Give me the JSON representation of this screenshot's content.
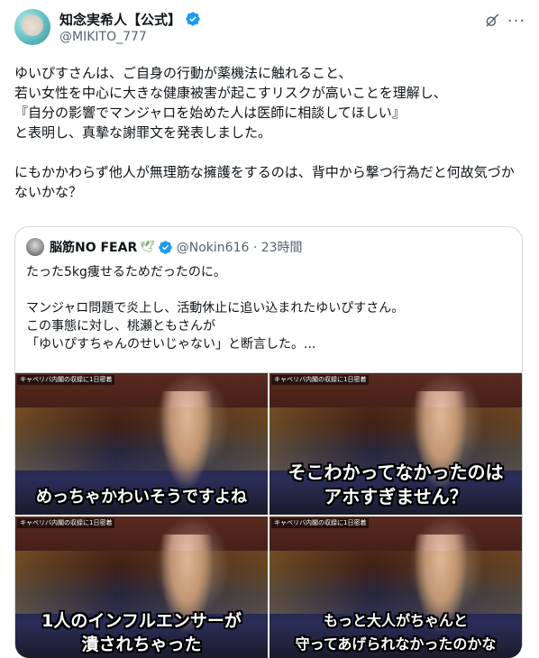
{
  "author": {
    "display_name": "知念実希人【公式】",
    "handle": "@MIKITO_777",
    "avatar_icon": "avatar-icon",
    "verified_color": "#1d9bf0"
  },
  "header_icons": {
    "grok": "grok-icon",
    "more": "more-icon"
  },
  "tweet": {
    "text": "ゆいぴすさんは、ご自身の行動が薬機法に触れること、\n若い女性を中心に大きな健康被害が起こすリスクが高いことを理解し、\n『自分の影響でマンジャロを始めた人は医師に相談してほしい』\nと表明し、真摯な謝罪文を発表しました。\n\nにもかかわらず他人が無理筋な擁護をするのは、背中から撃つ行為だと何故気づかないかな？"
  },
  "quote": {
    "display_name": "脳筋NO FEAR",
    "emoji": "🕊",
    "handle_time": "@Nokin616 · 23時間",
    "text": "たった5kg痩せるためだったのに。\n\nマンジャロ問題で炎上し、活動休止に追い込まれたゆいぴすさん。\nこの事態に対し、桃瀬ともさんが\n「ゆいぴすちゃんのせいじゃない」と断言した。...",
    "media": [
      {
        "tag": "キャベリバ内閣の収録に1日密着",
        "caption": "めっちゃかわいそうですよね"
      },
      {
        "tag": "キャベリバ内閣の収録に1日密着",
        "caption": "そこわかってなかったのは\nアホすぎません？"
      },
      {
        "tag": "キャベリバ内閣の収録に1日密着",
        "caption": "1人のインフルエンサーが\n潰されちゃった"
      },
      {
        "tag": "キャベリバ内閣の収録に1日密着",
        "caption": "もっと大人がちゃんと\n守ってあげられなかったのかな"
      }
    ]
  }
}
